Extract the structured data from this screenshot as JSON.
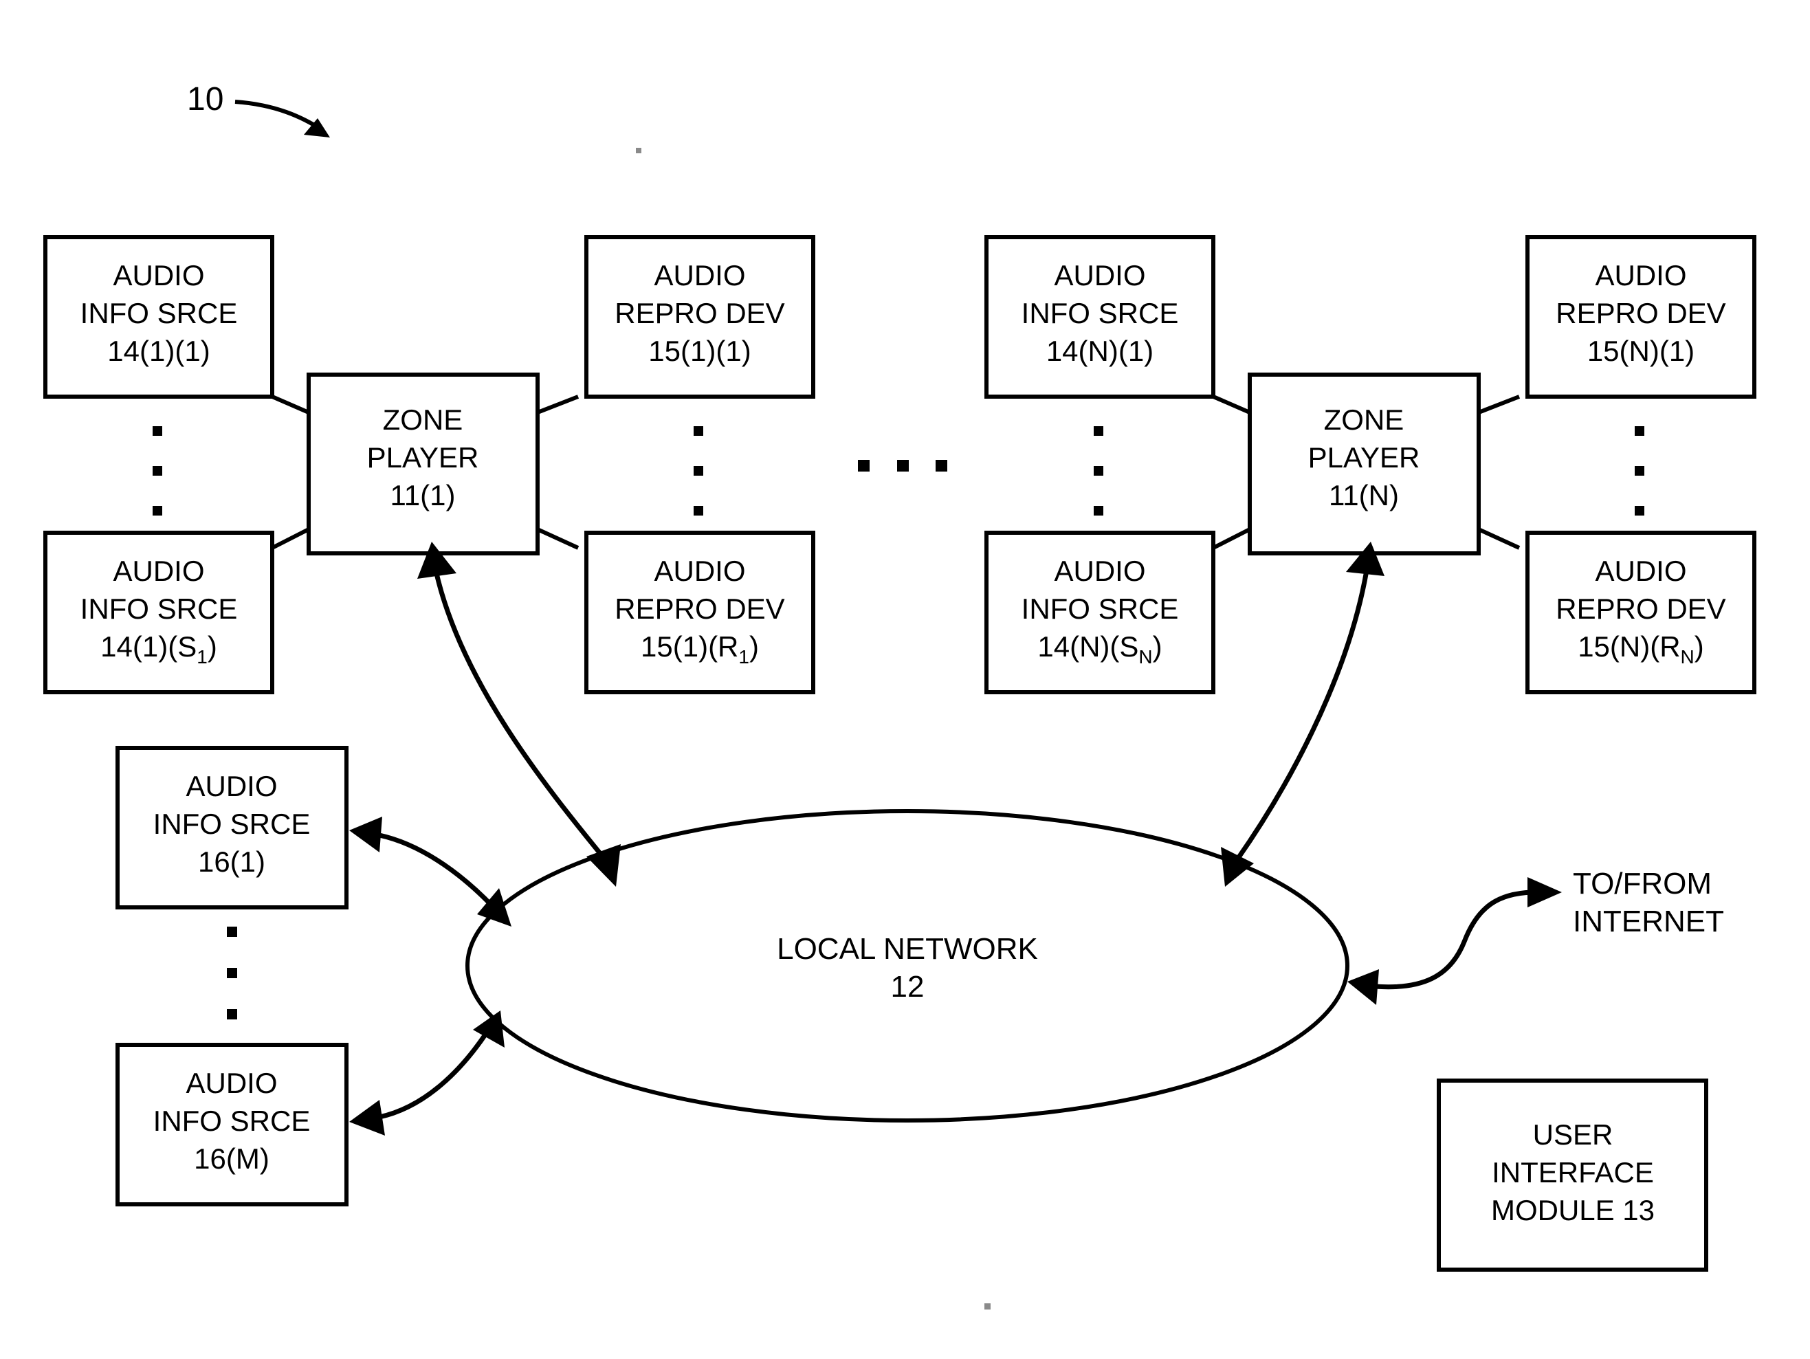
{
  "figure": {
    "reference_numeral": "10",
    "background_color": "#ffffff",
    "line_color": "#000000"
  },
  "zone_groups": [
    {
      "id": "group-1",
      "zone_player": {
        "line1": "ZONE",
        "line2": "PLAYER",
        "line3": "11(1)"
      },
      "sources": [
        {
          "line1": "AUDIO",
          "line2": "INFO SRCE",
          "line3_prefix": "14(1)(1)",
          "line3_sub": "",
          "line3_suffix": ""
        },
        {
          "line1": "AUDIO",
          "line2": "INFO SRCE",
          "line3_prefix": "14(1)(S",
          "line3_sub": "1",
          "line3_suffix": ")"
        }
      ],
      "repro_devices": [
        {
          "line1": "AUDIO",
          "line2": "REPRO DEV",
          "line3_prefix": "15(1)(1)",
          "line3_sub": "",
          "line3_suffix": ""
        },
        {
          "line1": "AUDIO",
          "line2": "REPRO DEV",
          "line3_prefix": "15(1)(R",
          "line3_sub": "1",
          "line3_suffix": ")"
        }
      ]
    },
    {
      "id": "group-n",
      "zone_player": {
        "line1": "ZONE",
        "line2": "PLAYER",
        "line3": "11(N)"
      },
      "sources": [
        {
          "line1": "AUDIO",
          "line2": "INFO SRCE",
          "line3_prefix": "14(N)(1)",
          "line3_sub": "",
          "line3_suffix": ""
        },
        {
          "line1": "AUDIO",
          "line2": "INFO SRCE",
          "line3_prefix": "14(N)(S",
          "line3_sub": "N",
          "line3_suffix": ")"
        }
      ],
      "repro_devices": [
        {
          "line1": "AUDIO",
          "line2": "REPRO DEV",
          "line3_prefix": "15(N)(1)",
          "line3_sub": "",
          "line3_suffix": ""
        },
        {
          "line1": "AUDIO",
          "line2": "REPRO DEV",
          "line3_prefix": "15(N)(R",
          "line3_sub": "N",
          "line3_suffix": ")"
        }
      ]
    }
  ],
  "network": {
    "line1": "LOCAL NETWORK",
    "line2": "12"
  },
  "network_sources": [
    {
      "line1": "AUDIO",
      "line2": "INFO SRCE",
      "line3": "16(1)"
    },
    {
      "line1": "AUDIO",
      "line2": "INFO SRCE",
      "line3": "16(M)"
    }
  ],
  "internet_label": {
    "line1": "TO/FROM",
    "line2": "INTERNET"
  },
  "user_interface_module": {
    "line1": "USER",
    "line2": "INTERFACE",
    "line3": "MODULE 13"
  }
}
